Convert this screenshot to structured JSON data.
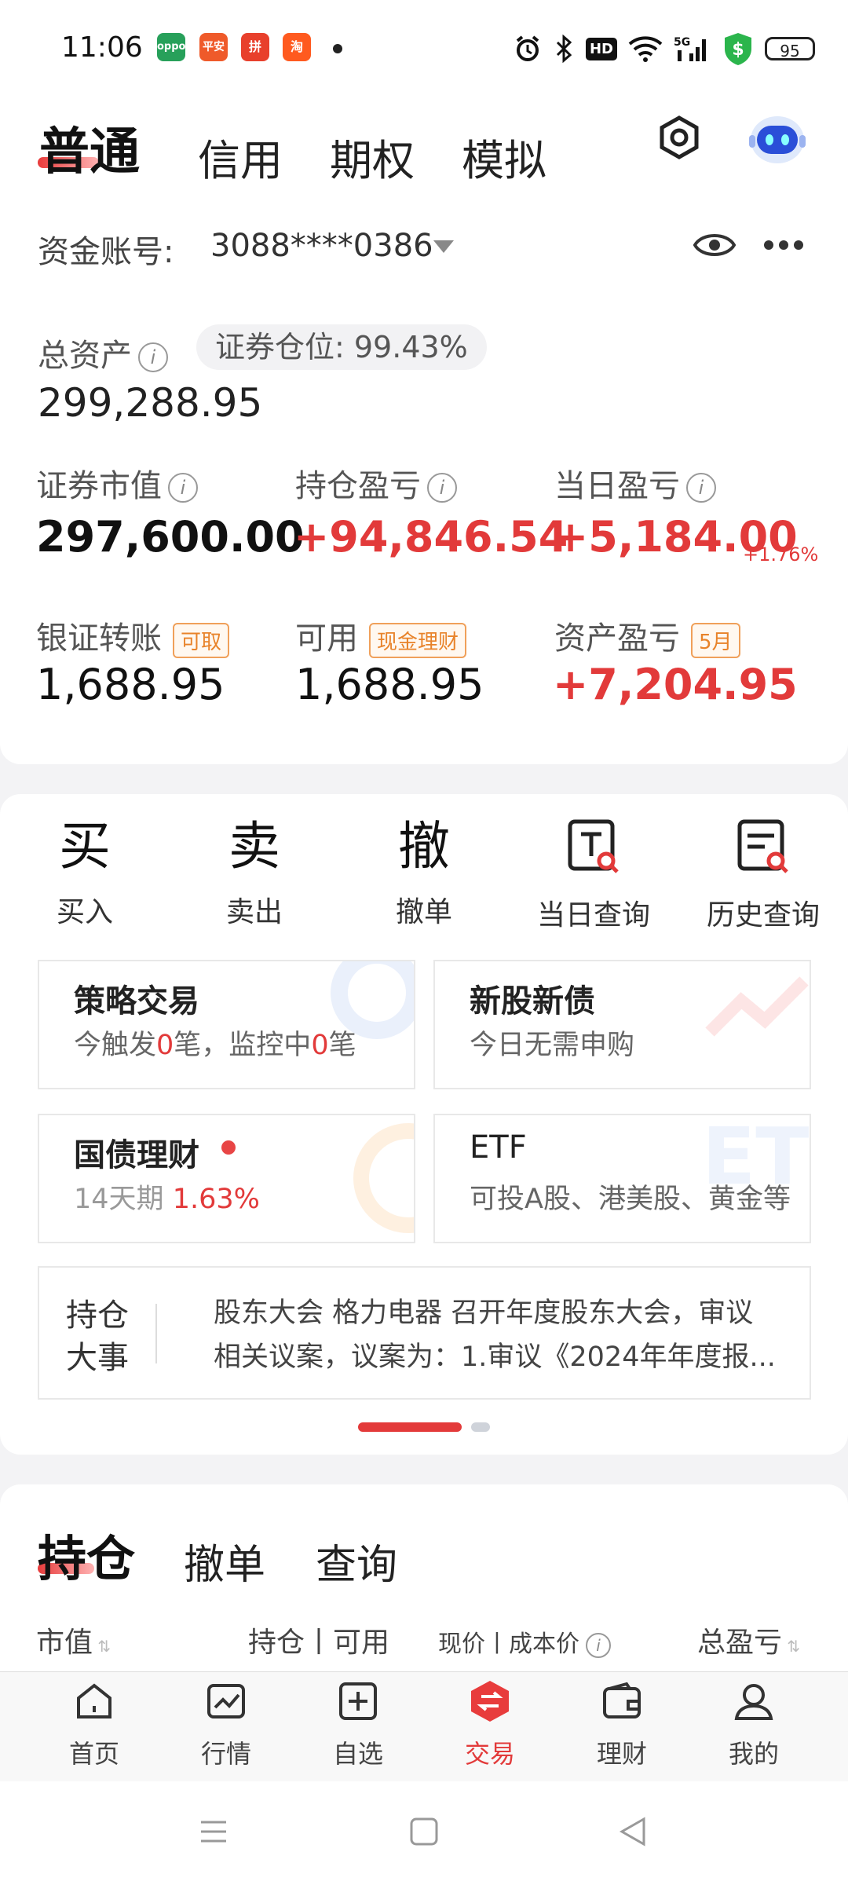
{
  "status_bar": {
    "time": "11:06",
    "battery": "95",
    "app_icons": [
      {
        "name": "oppo",
        "label": "oppo",
        "color": "#27a05a"
      },
      {
        "name": "pingan",
        "label": "平安",
        "color": "#ef5a2a"
      },
      {
        "name": "pinduoduo",
        "label": "拼",
        "color": "#e8402c"
      },
      {
        "name": "taobao",
        "label": "淘",
        "color": "#ff5a1f"
      }
    ]
  },
  "tabs": {
    "active": "普通",
    "items": [
      "信用",
      "期权",
      "模拟"
    ]
  },
  "account": {
    "label": "资金账号:",
    "number": "3088****0386"
  },
  "assets": {
    "total_label": "总资产",
    "total_value": "299,288.95",
    "position_pill": "证券仓位: 99.43%",
    "market_value_label": "证券市值",
    "market_value": "297,600.00",
    "holding_pl_label": "持仓盈亏",
    "holding_pl": "+94,846.54",
    "daily_pl_label": "当日盈亏",
    "daily_pl": "+5,184.00",
    "daily_pct": "+1.76%",
    "transfer_label": "银证转账",
    "transfer_tag": "可取",
    "transfer_value": "1,688.95",
    "available_label": "可用",
    "available_tag": "现金理财",
    "available_value": "1,688.95",
    "asset_pl_label": "资产盈亏",
    "asset_pl_tag": "5月",
    "asset_pl_value": "+7,204.95"
  },
  "quick_actions": [
    {
      "glyph": "买",
      "label": "买入"
    },
    {
      "glyph": "卖",
      "label": "卖出"
    },
    {
      "glyph": "撤",
      "label": "撤单"
    },
    {
      "glyph": "",
      "label": "当日查询"
    },
    {
      "glyph": "",
      "label": "历史查询"
    }
  ],
  "features": {
    "strategy_title": "策略交易",
    "strategy_sub_a": "今触发",
    "strategy_count1": "0",
    "strategy_sub_b": "笔，监控中",
    "strategy_count2": "0",
    "strategy_sub_c": "笔",
    "ipo_title": "新股新债",
    "ipo_sub": "今日无需申购",
    "bond_title": "国债理财",
    "bond_term": "14天期",
    "bond_rate": "1.63%",
    "etf_title": "ETF",
    "etf_sub": "可投A股、港美股、黄金等"
  },
  "event": {
    "label_line1": "持仓",
    "label_line2": "大事",
    "text_line1": "股东大会 格力电器 召开年度股东大会，审议",
    "text_line2": "相关议案，议案为：1.审议《2024年年度报..."
  },
  "holdings": {
    "tabs": [
      "持仓",
      "撤单",
      "查询"
    ],
    "col_market": "市值",
    "col_position": "持仓丨可用",
    "col_price": "现价丨成本价",
    "col_total": "总盈亏"
  },
  "bottom_nav": [
    "首页",
    "行情",
    "自选",
    "交易",
    "理财",
    "我的"
  ],
  "colors": {
    "accent": "#e23a3a",
    "tag": "#e8832a"
  }
}
